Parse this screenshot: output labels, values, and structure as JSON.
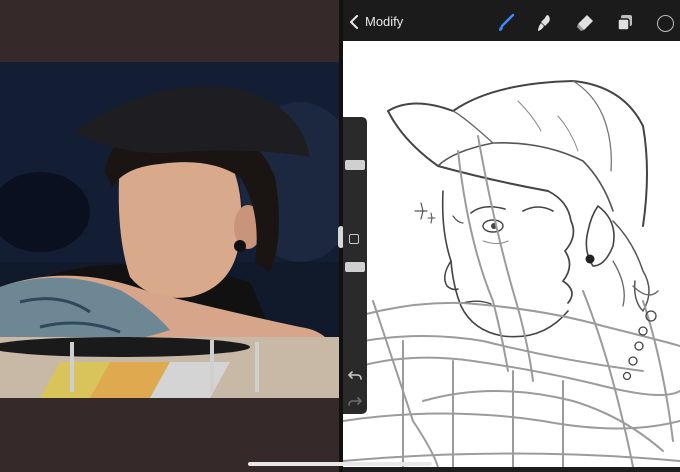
{
  "toolbar": {
    "back_label": "Modify",
    "tools": [
      {
        "name": "brush",
        "icon": "brush-icon",
        "active": true
      },
      {
        "name": "smudge",
        "icon": "smudge-icon",
        "active": false
      },
      {
        "name": "eraser",
        "icon": "eraser-icon",
        "active": false
      },
      {
        "name": "layers",
        "icon": "layers-icon",
        "active": false
      },
      {
        "name": "color",
        "icon": "color-swatch",
        "active": false
      }
    ]
  },
  "colors": {
    "active_tool": "#3b8cff",
    "toolbar_bg": "#1b1b1b",
    "canvas_bg": "#ffffff",
    "split_bg": "#2f2524",
    "current_color": "#1a1a1a"
  },
  "sidebar": {
    "brush_size": 0.25,
    "brush_opacity": 0.52
  }
}
